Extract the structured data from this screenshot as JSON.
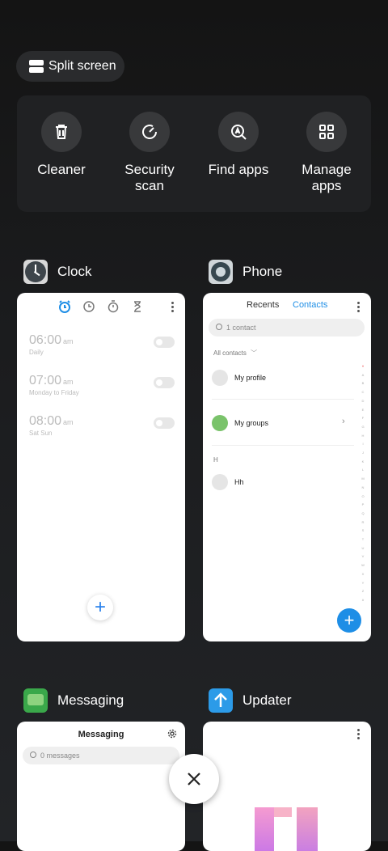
{
  "split_screen": {
    "label": "Split screen",
    "icon": "split-screen-icon"
  },
  "tools": [
    {
      "label": "Cleaner",
      "icon": "trash-icon"
    },
    {
      "label": "Security scan",
      "icon": "security-scan-icon"
    },
    {
      "label": "Find apps",
      "icon": "find-apps-icon"
    },
    {
      "label": "Manage apps",
      "icon": "grid-apps-icon"
    }
  ],
  "recent_apps": {
    "clock": {
      "title": "Clock",
      "alarms": [
        {
          "time": "06:00",
          "ampm": "am",
          "repeat": "Daily"
        },
        {
          "time": "07:00",
          "ampm": "am",
          "repeat": "Monday to Friday"
        },
        {
          "time": "08:00",
          "ampm": "am",
          "repeat": "Sat Sun"
        }
      ],
      "fab": "+"
    },
    "phone": {
      "title": "Phone",
      "tabs": {
        "recents": "Recents",
        "contacts": "Contacts"
      },
      "search_placeholder": "1 contact",
      "filter": "All contacts",
      "rows": {
        "profile": "My profile",
        "groups": "My groups",
        "section": "H",
        "contact": "Hh"
      },
      "alpha_index": "♥ A B C D E F G H I J K L M N O P Q R S T U V W X Y Z #",
      "fab": "+"
    },
    "messaging": {
      "title": "Messaging",
      "header": "Messaging",
      "search_placeholder": "0 messages"
    },
    "updater": {
      "title": "Updater"
    }
  },
  "colors": {
    "accent": "#1e8ee6",
    "background": "#1b1c1e"
  }
}
